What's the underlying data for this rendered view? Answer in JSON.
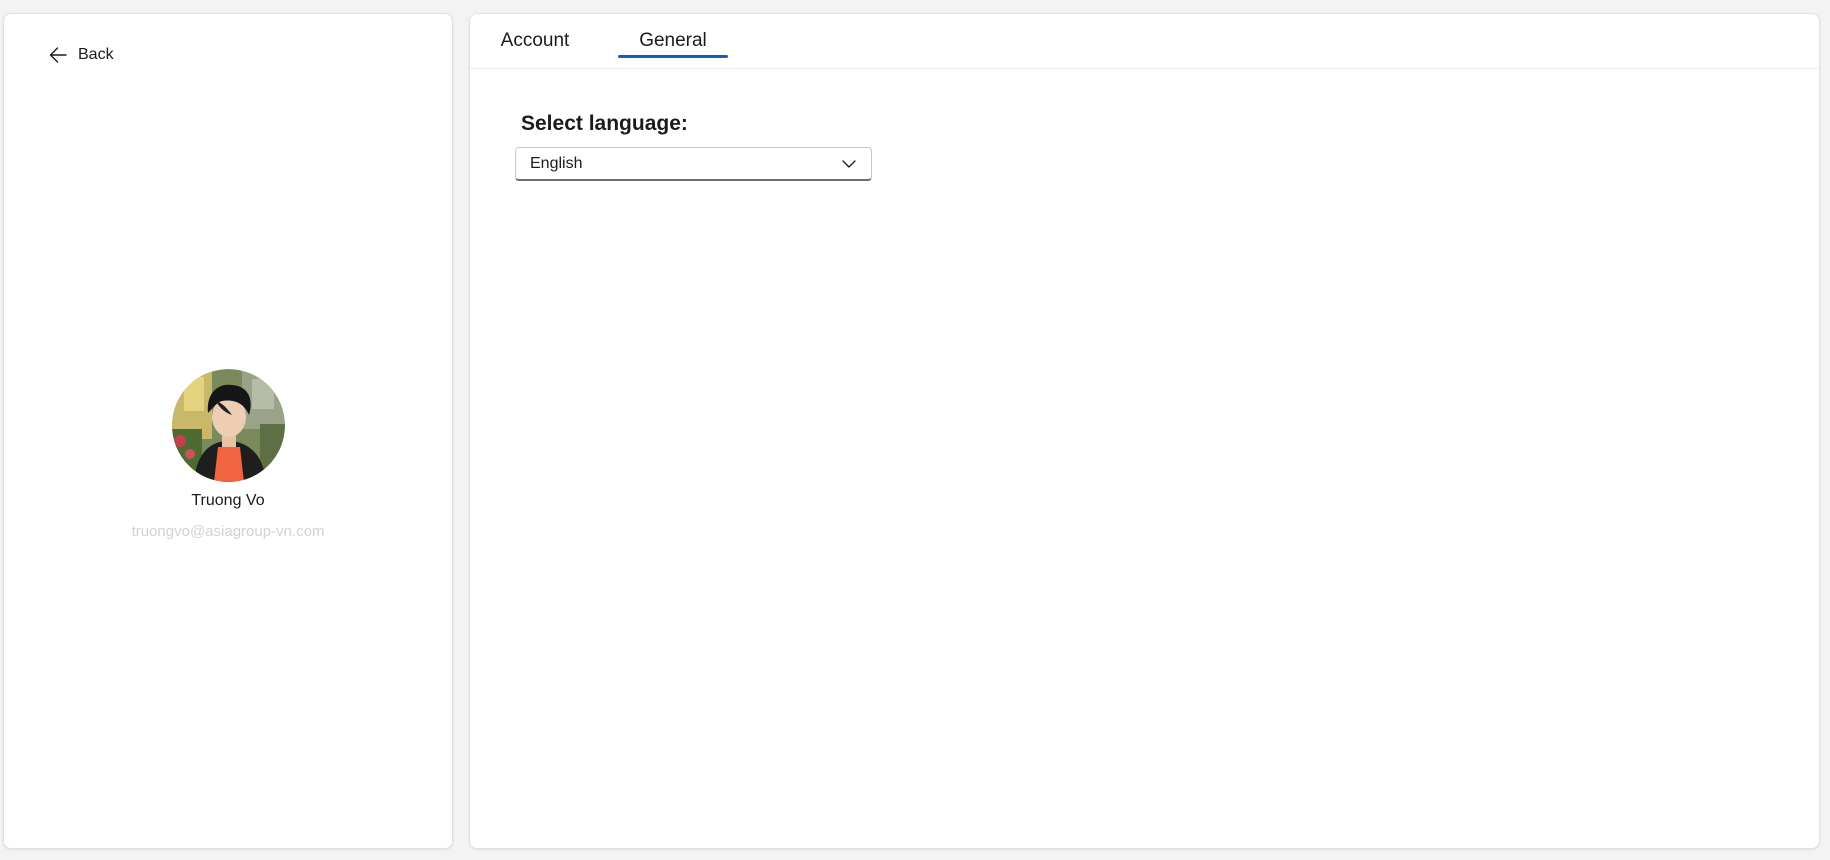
{
  "navigation": {
    "back_label": "Back",
    "back_icon": "arrow-left-icon"
  },
  "profile": {
    "name": "Truong Vo",
    "email": "truongvo@asiagroup-vn.com",
    "avatar_icon": "user-avatar-photo"
  },
  "tabs": [
    {
      "label": "Account",
      "active": false
    },
    {
      "label": "General",
      "active": true
    }
  ],
  "general": {
    "language_label": "Select language:",
    "language_selected": "English",
    "dropdown_icon": "chevron-down-icon"
  },
  "colors": {
    "background": "#f3f3f3",
    "panel": "#ffffff",
    "accent": "#0f5ec7",
    "email_text": "#d2d2d2"
  }
}
